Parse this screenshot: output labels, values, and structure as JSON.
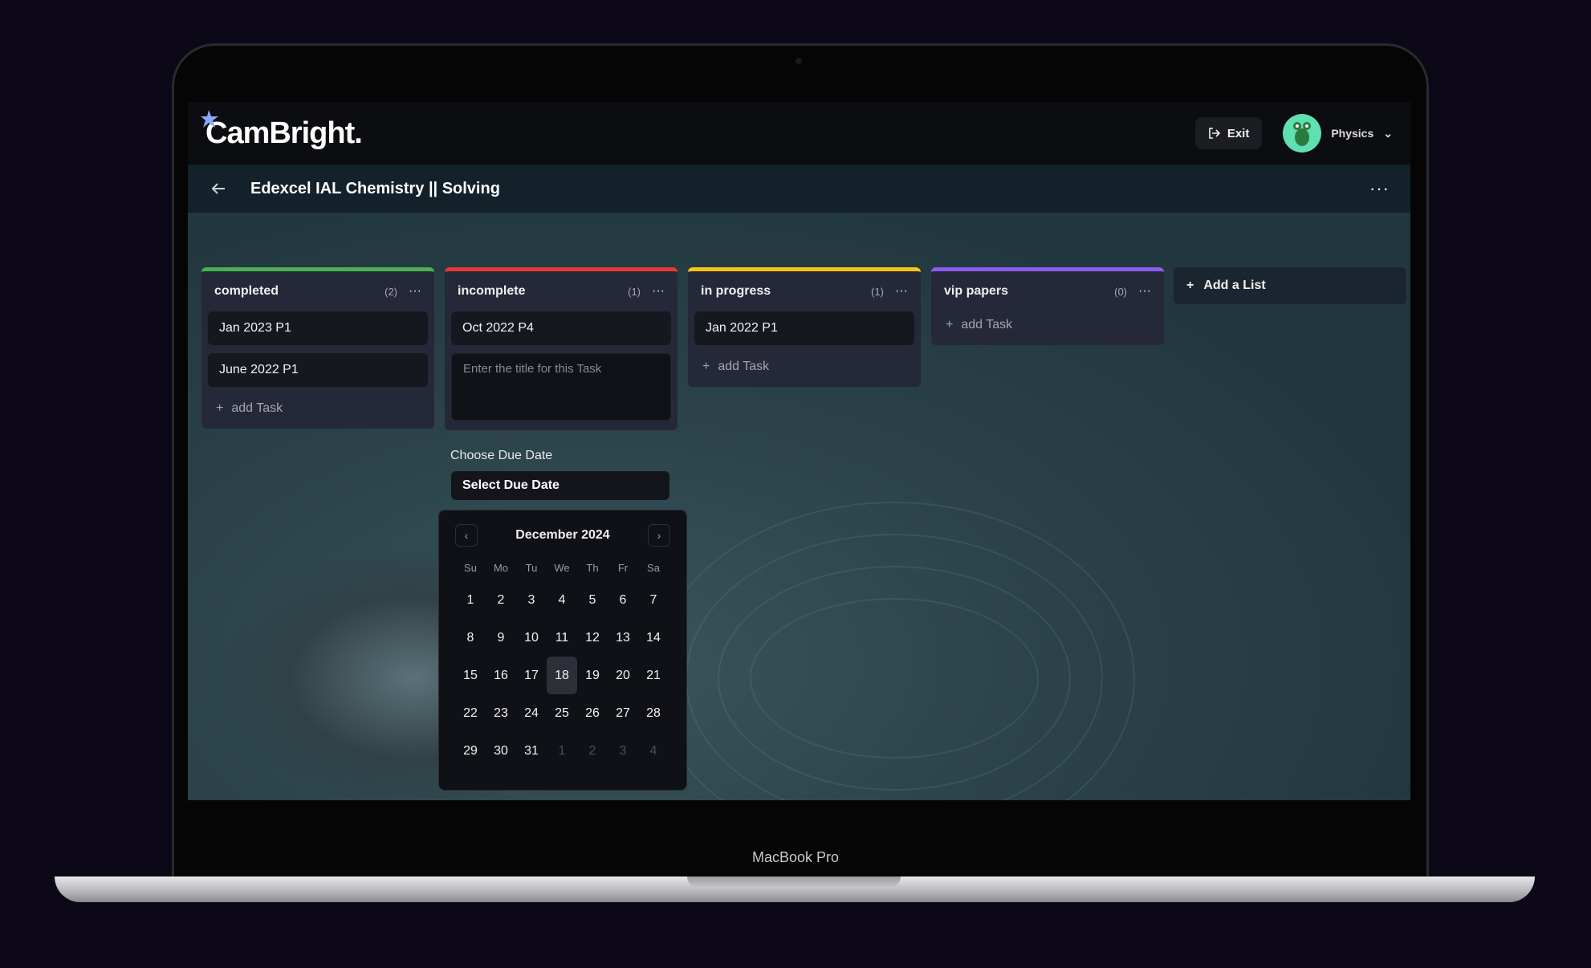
{
  "device": {
    "brand_label": "MacBook Pro"
  },
  "header": {
    "logo": "CamBright.",
    "exit_label": "Exit",
    "profile_name": "Physics"
  },
  "board": {
    "title": "Edexcel IAL Chemistry || Solving",
    "menu": "···"
  },
  "lists": [
    {
      "title": "completed",
      "count": "(2)",
      "color": "#4caf50",
      "cards": [
        "Jan 2023 P1",
        "June 2022 P1"
      ],
      "add_label": "add Task"
    },
    {
      "title": "incomplete",
      "count": "(1)",
      "color": "#e53935",
      "cards": [
        "Oct 2022 P4"
      ],
      "input_placeholder": "Enter the title for this Task"
    },
    {
      "title": "in progress",
      "count": "(1)",
      "color": "#f5c518",
      "cards": [
        "Jan 2022 P1"
      ],
      "add_label": "add Task"
    },
    {
      "title": "vip papers",
      "count": "(0)",
      "color": "#8c5cf0",
      "cards": [],
      "add_label": "add Task"
    }
  ],
  "add_list_label": "Add a List",
  "due": {
    "label": "Choose Due Date",
    "button": "Select Due Date"
  },
  "calendar": {
    "month": "December 2024",
    "weekdays": [
      "Su",
      "Mo",
      "Tu",
      "We",
      "Th",
      "Fr",
      "Sa"
    ],
    "days": [
      "1",
      "2",
      "3",
      "4",
      "5",
      "6",
      "7",
      "8",
      "9",
      "10",
      "11",
      "12",
      "13",
      "14",
      "15",
      "16",
      "17",
      "18",
      "19",
      "20",
      "21",
      "22",
      "23",
      "24",
      "25",
      "26",
      "27",
      "28",
      "29",
      "30",
      "31"
    ],
    "trailing_days": [
      "1",
      "2",
      "3",
      "4"
    ],
    "selected": "18"
  }
}
